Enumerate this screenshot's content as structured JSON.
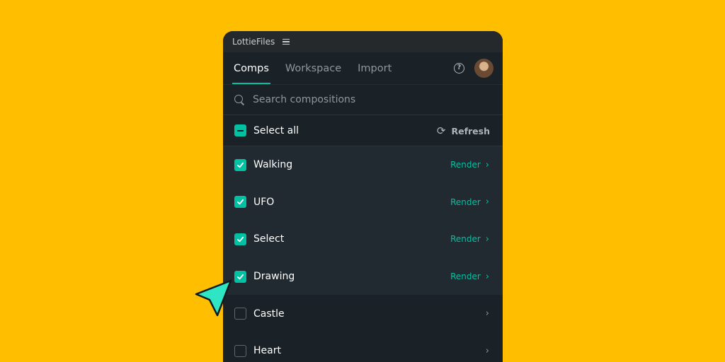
{
  "titlebar": {
    "title": "LottieFiles",
    "menu_icon": "hamburger-menu-icon"
  },
  "tabs": [
    {
      "label": "Comps",
      "active": true
    },
    {
      "label": "Workspace",
      "active": false
    },
    {
      "label": "Import",
      "active": false
    }
  ],
  "header_icons": {
    "help": "?"
  },
  "search": {
    "placeholder": "Search compositions"
  },
  "select_all": {
    "label": "Select all",
    "state": "partial",
    "refresh_label": "Refresh"
  },
  "comps": [
    {
      "name": "Walking",
      "checked": true,
      "render_label": "Render"
    },
    {
      "name": "UFO",
      "checked": true,
      "render_label": "Render"
    },
    {
      "name": "Select",
      "checked": true,
      "render_label": "Render"
    },
    {
      "name": "Drawing",
      "checked": true,
      "render_label": "Render"
    },
    {
      "name": "Castle",
      "checked": false,
      "render_label": ""
    },
    {
      "name": "Heart",
      "checked": false,
      "render_label": ""
    }
  ],
  "colors": {
    "background": "#FFBE00",
    "panel": "#1B2227",
    "accent": "#00C1A2"
  }
}
